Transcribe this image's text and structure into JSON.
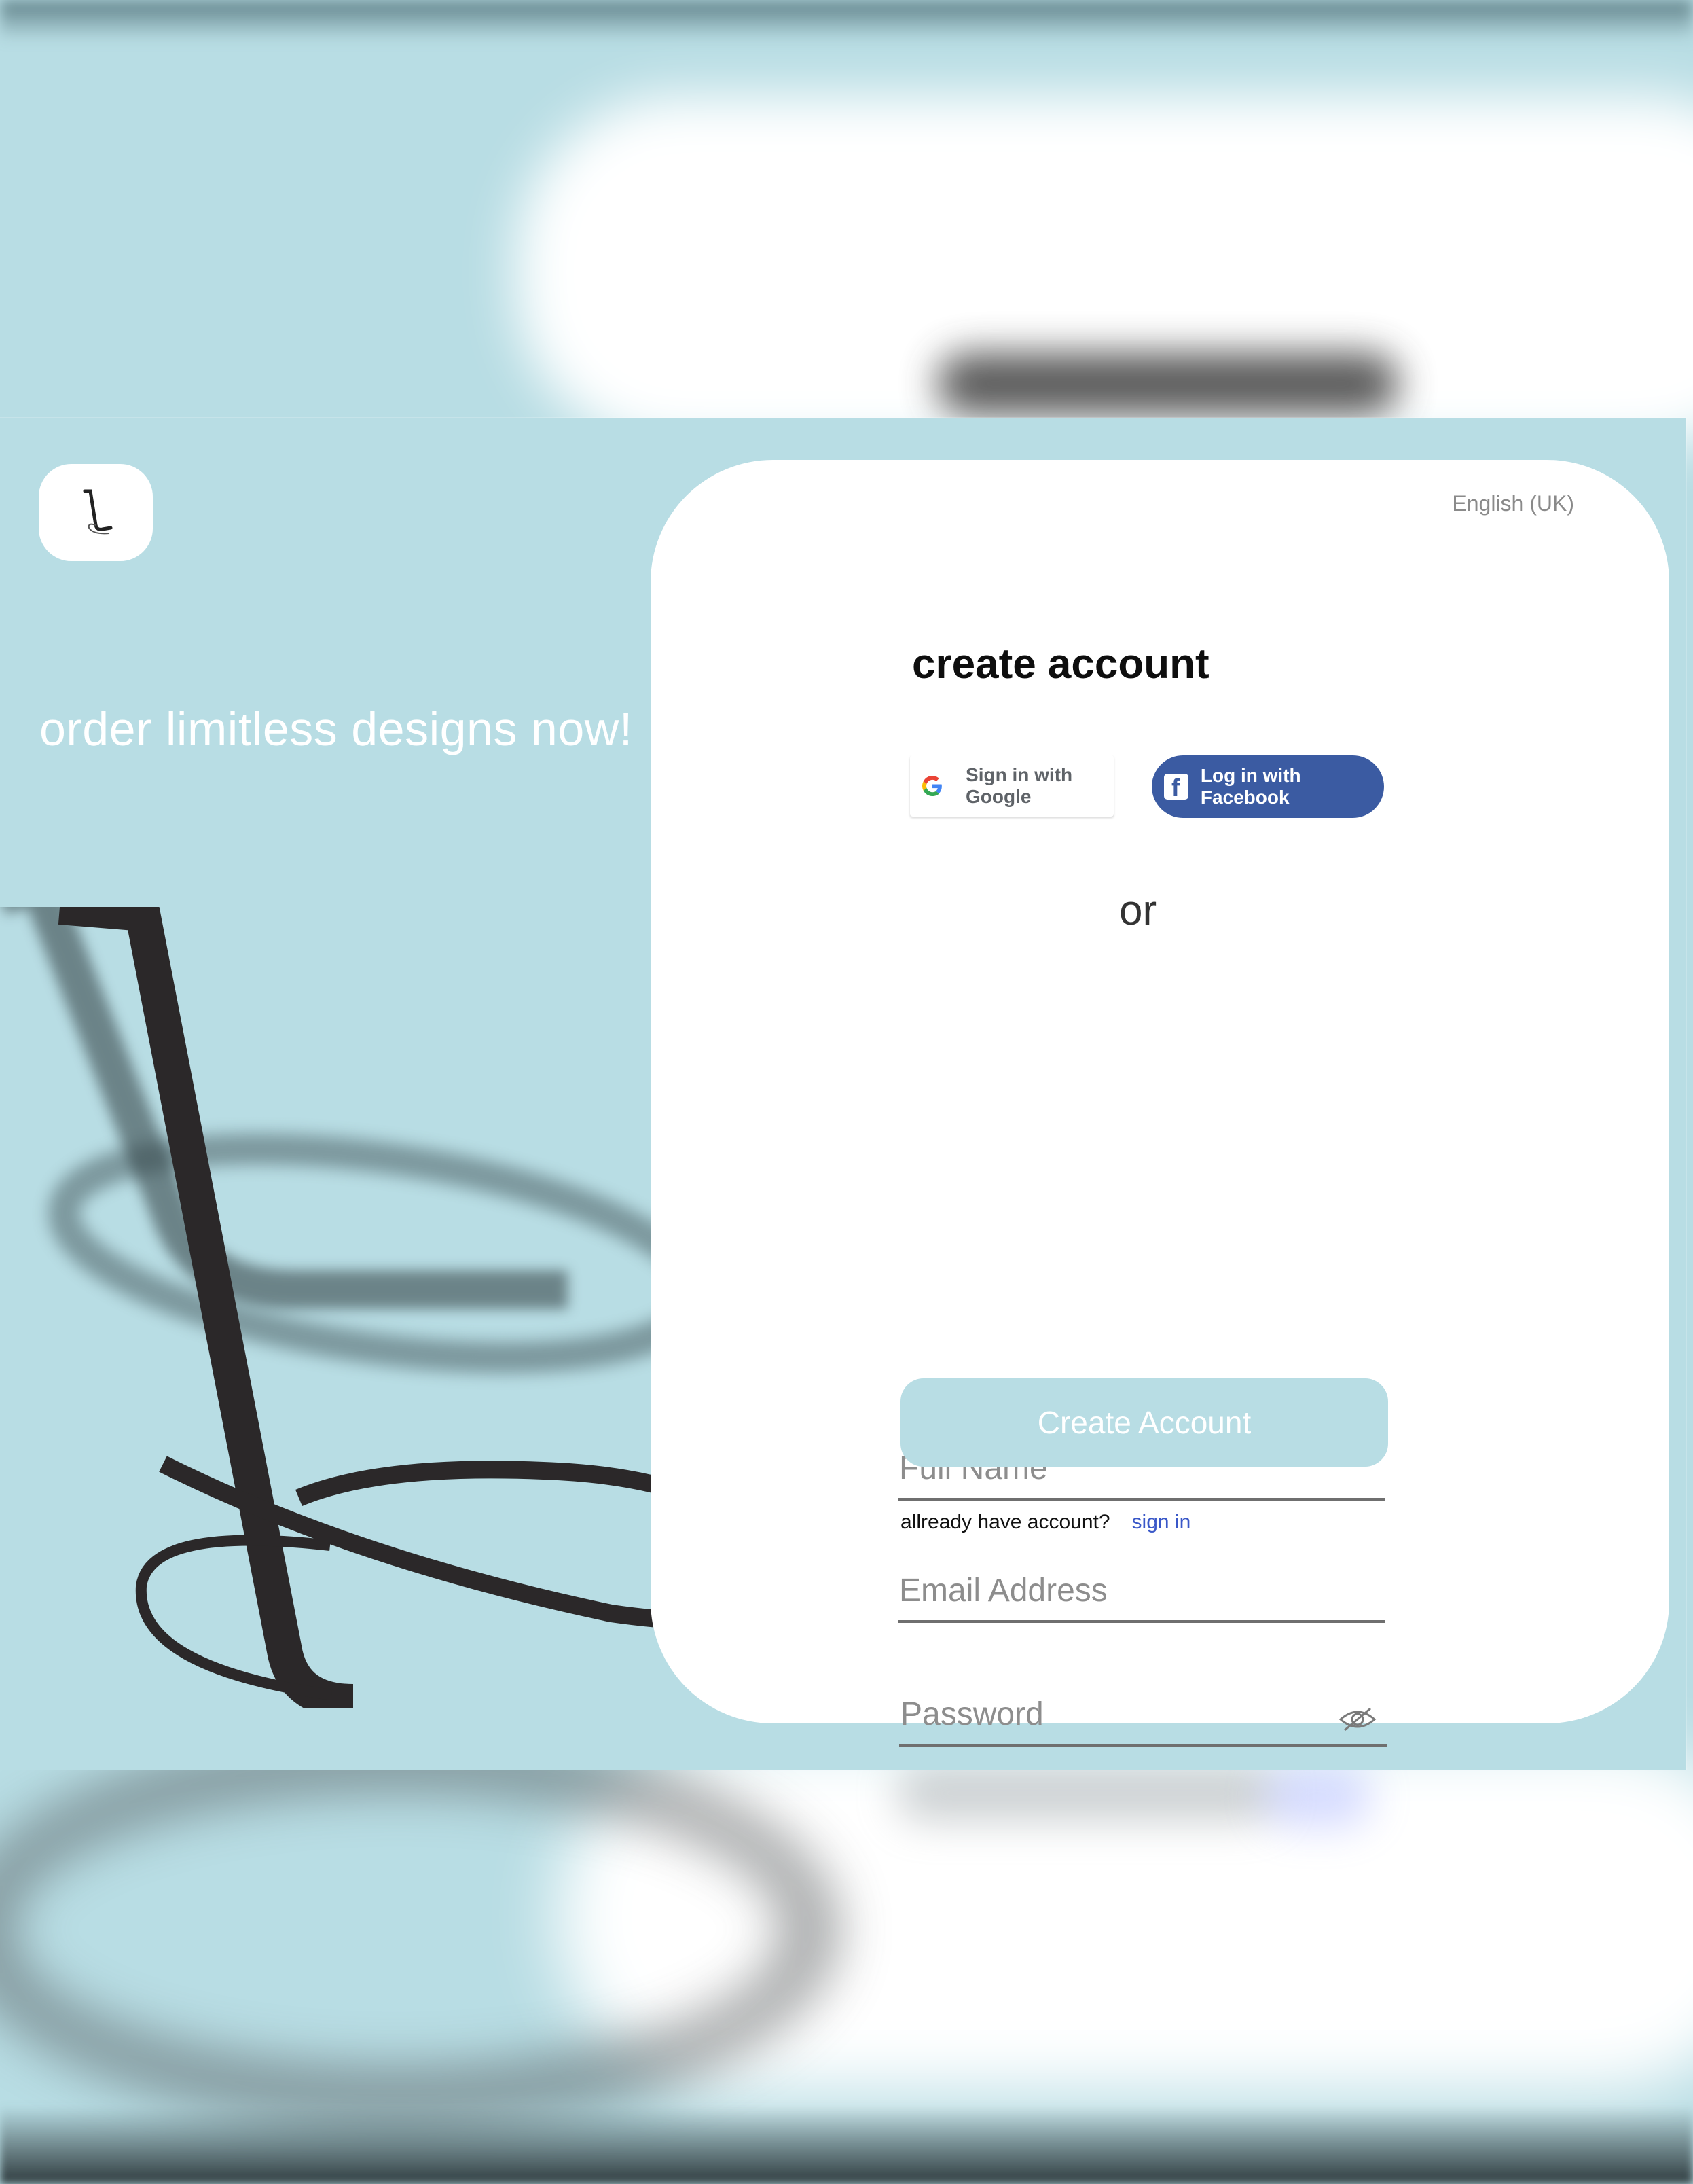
{
  "hero": {
    "tagline": "order limitless designs now!"
  },
  "form": {
    "language": "English (UK)",
    "title": "create account",
    "google_label": "Sign in with Google",
    "facebook_label": "Log in with Facebook",
    "separator": "or",
    "full_name_placeholder": "Full Name",
    "email_placeholder": "Email Address",
    "password_placeholder": "Password",
    "submit_label": "Create Account",
    "signin_prompt": "allready have account?",
    "signin_link": "sign in"
  },
  "icons": {
    "logo": "script-l-logo-icon",
    "google": "google-g-icon",
    "facebook": "facebook-f-icon",
    "password_toggle": "eye-slash-icon"
  },
  "colors": {
    "background": "#b8dde4",
    "card": "#ffffff",
    "facebook_blue": "#3b5ba2",
    "link_blue": "#3a58c8",
    "submit_button": "#b8dde4"
  }
}
